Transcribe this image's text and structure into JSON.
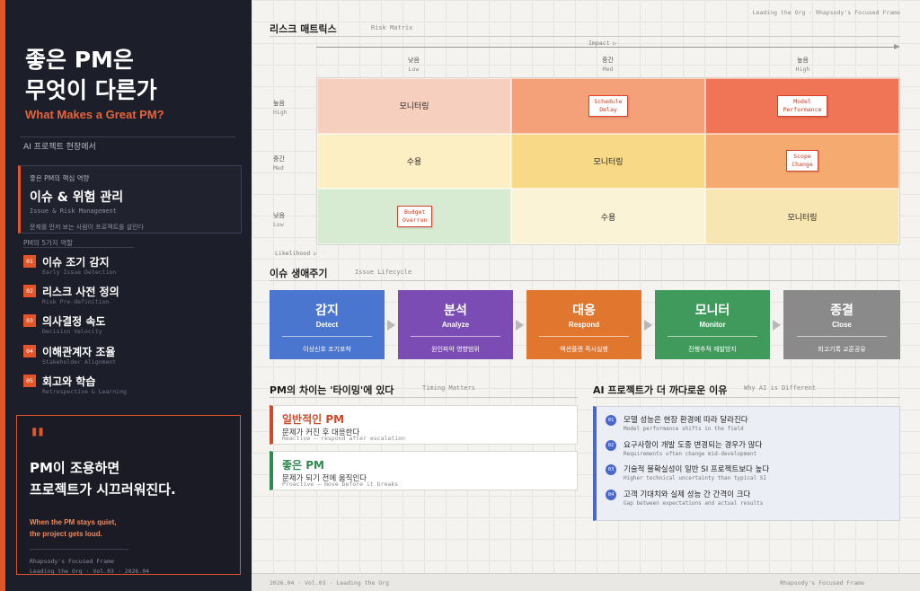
{
  "sidebar": {
    "title_line1": "좋은 PM은",
    "title_line2": "무엇이 다른가",
    "title_en": "What Makes a Great PM?",
    "intro": "AI 프로젝트 현장에서",
    "core": {
      "eyebrow": "좋은 PM의 핵심 역량",
      "title": "이슈 & 위험 관리",
      "title_en": "Issue & Risk Management",
      "desc": "문제를 먼저 보는 사람이 프로젝트를 살린다"
    },
    "roles_label": "PM의 5가지 역할",
    "roles": [
      {
        "num": "01",
        "ko": "이슈 조기 감지",
        "en": "Early Issue Detection"
      },
      {
        "num": "02",
        "ko": "리스크 사전 정의",
        "en": "Risk Pre-definition"
      },
      {
        "num": "03",
        "ko": "의사결정 속도",
        "en": "Decision Velocity"
      },
      {
        "num": "04",
        "ko": "이해관계자 조율",
        "en": "Stakeholder Alignment"
      },
      {
        "num": "05",
        "ko": "회고와 학습",
        "en": "Retrospective & Learning"
      }
    ],
    "quote": {
      "mark": "\"",
      "ko_line1": "PM이 조용하면",
      "ko_line2": "프로젝트가 시끄러워진다.",
      "en_line1": "When the PM stays quiet,",
      "en_line2": "the project gets loud.",
      "foot_line1": "Rhapsody's Focused Frame",
      "foot_line2": "Leading the Org  ·  Vol.03  ·  2026.04"
    }
  },
  "main": {
    "top_meta": "Leading the Org  ·  Rhapsody's Focused Frame",
    "risk_matrix": {
      "title": "리스크 매트릭스",
      "title_en": "Risk Matrix",
      "impact_label": "Impact ▷",
      "likelihood_label": "Likelihood ▷",
      "columns": [
        {
          "ko": "낮음",
          "en": "Low"
        },
        {
          "ko": "중간",
          "en": "Med"
        },
        {
          "ko": "높음",
          "en": "High"
        }
      ],
      "rows": [
        {
          "ko": "높음",
          "en": "High"
        },
        {
          "ko": "중간",
          "en": "Med"
        },
        {
          "ko": "낮음",
          "en": "Low"
        }
      ],
      "cells": [
        {
          "text": "모니터링",
          "color": "#f6cfbf"
        },
        {
          "tag_l1": "Schedule",
          "tag_l2": "Delay",
          "color": "#f4a079"
        },
        {
          "tag_l1": "Model",
          "tag_l2": "Performance",
          "color": "#f07556"
        },
        {
          "text": "수용",
          "color": "#fcefc4"
        },
        {
          "text": "모니터링",
          "color": "#f8d988"
        },
        {
          "tag_l1": "Scope",
          "tag_l2": "Change",
          "color": "#f5aa6f"
        },
        {
          "tag_l1": "Budget",
          "tag_l2": "Overrun",
          "color": "#d7ebd2"
        },
        {
          "text": "수용",
          "color": "#fbf3d6"
        },
        {
          "text": "모니터링",
          "color": "#f7e6b2"
        }
      ]
    },
    "lifecycle": {
      "title": "이슈 생애주기",
      "title_en": "Issue Lifecycle",
      "steps": [
        {
          "ko": "감지",
          "en": "Detect",
          "desc": "이상신호 조기포착",
          "color": "#4a76cf"
        },
        {
          "ko": "분석",
          "en": "Analyze",
          "desc": "원인파악 영향범위",
          "color": "#7b4cb3"
        },
        {
          "ko": "대응",
          "en": "Respond",
          "desc": "액션플랜 즉시실행",
          "color": "#e1762f"
        },
        {
          "ko": "모니터",
          "en": "Monitor",
          "desc": "진행추적 재발방지",
          "color": "#3f9a5c"
        },
        {
          "ko": "종결",
          "en": "Close",
          "desc": "회고기록 교훈공유",
          "color": "#8a8a8a"
        }
      ]
    },
    "timing": {
      "title": "PM의 차이는 '타이밍'에 있다",
      "title_en": "Timing Matters",
      "cards": [
        {
          "title": "일반적인 PM",
          "desc": "문제가 커진 후 대응한다",
          "en": "Reactive — respond after escalation",
          "color": "#d04a2a"
        },
        {
          "title": "좋은 PM",
          "desc": "문제가 되기 전에 움직인다",
          "en": "Proactive — move before it breaks",
          "color": "#2f8a4f"
        }
      ]
    },
    "ai": {
      "title": "AI 프로젝트가 더 까다로운 이유",
      "title_en": "Why AI is Different",
      "items": [
        {
          "num": "01",
          "ko": "모델 성능은 현장 환경에 따라 달라진다",
          "en": "Model performance shifts in the field"
        },
        {
          "num": "02",
          "ko": "요구사항이 개발 도중 변경되는 경우가 많다",
          "en": "Requirements often change mid-development"
        },
        {
          "num": "03",
          "ko": "기술적 불확실성이 일반 SI 프로젝트보다 높다",
          "en": "Higher technical uncertainty than typical SI"
        },
        {
          "num": "04",
          "ko": "고객 기대치와 실제 성능 간 간격이 크다",
          "en": "Gap between expectations and actual results"
        }
      ]
    },
    "footer_left": "2026.04  ·  Vol.03  ·  Leading the Org",
    "footer_right": "Rhapsody's Focused Frame"
  }
}
